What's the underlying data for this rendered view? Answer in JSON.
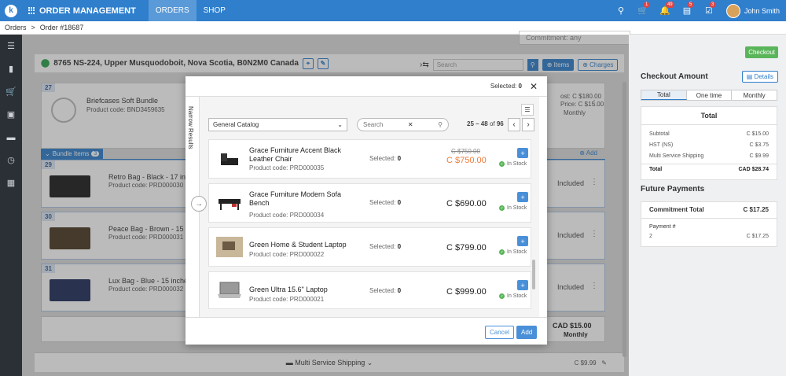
{
  "topbar": {
    "logo": "k",
    "app_title": "ORDER MANAGEMENT",
    "nav": [
      "ORDERS",
      "SHOP"
    ],
    "cart_badge": "1",
    "bell_badge": "49",
    "clip_badge": "5",
    "check_badge": "3",
    "user": "John Smith"
  },
  "breadcrumb": {
    "root": "Orders",
    "sep": ">",
    "current": "Order #18687"
  },
  "order": {
    "commitment": "Commitment: any",
    "address": "8765 NS-224, Upper Musquodoboit, Nova Scotia, B0N2M0 Canada",
    "search_placeholder": "Search",
    "items_btn": "Items",
    "charges_btn": "Charges",
    "bundle": {
      "num": "27",
      "name": "Briefcases Soft Bundle",
      "code": "Product code: BND3459635",
      "cost": "ost: C $180.00",
      "price": "Price: C $15.00",
      "period": "Monthly"
    },
    "bundle_label": "Bundle Items",
    "bundle_count": "3",
    "add_link": "Add",
    "items": [
      {
        "num": "29",
        "name": "Retro Bag - Black - 17 inches",
        "code": "Product code: PRD000030",
        "status": "Included"
      },
      {
        "num": "30",
        "name": "Peace Bag - Brown - 15 inches",
        "code": "Product code: PRD000031",
        "status": "Included"
      },
      {
        "num": "31",
        "name": "Lux Bag - Blue - 15 inches",
        "code": "Product code: PRD000032",
        "status": "Included"
      }
    ],
    "total": "CAD $15.00",
    "total_period": "Monthly",
    "shipping": "Multi Service Shipping",
    "shipping_price": "C $9.99"
  },
  "checkout": {
    "button": "Checkout",
    "title": "Checkout Amount",
    "details": "Details",
    "tabs": [
      "Total",
      "One time",
      "Monthly"
    ],
    "box_title": "Total",
    "rows": [
      {
        "label": "Subtotal",
        "value": "C $15.00"
      },
      {
        "label": "HST (NS)",
        "value": "C $3.75"
      },
      {
        "label": "Multi Service Shipping",
        "value": "C $9.99"
      }
    ],
    "total_label": "Total",
    "total_value": "CAD $28.74"
  },
  "future": {
    "title": "Future Payments",
    "commit_label": "Commitment Total",
    "commit_value": "C $17.25",
    "payment_label": "Payment #",
    "payment_num": "2",
    "payment_value": "C $17.25"
  },
  "modal": {
    "selected_label": "Selected:",
    "selected_count": "0",
    "narrow": "Narrow Results",
    "catalog": "General Catalog",
    "search_placeholder": "Search",
    "range": "25 – 48",
    "of": "of",
    "total": "96",
    "cancel": "Cancel",
    "add": "Add",
    "products": [
      {
        "name": "Grace Furniture Accent Black Leather Chair",
        "code": "Product code:  PRD000035",
        "selected": "0",
        "old_price": "C $750.00",
        "price": "C $750.00",
        "stock": "In Stock"
      },
      {
        "name": "Grace Furniture Modern Sofa Bench",
        "code": "Product code:  PRD000034",
        "selected": "0",
        "price": "C $690.00",
        "stock": "In Stock"
      },
      {
        "name": "Green Home & Student Laptop",
        "code": "Product code:  PRD000022",
        "selected": "0",
        "price": "C $799.00",
        "stock": "In Stock"
      },
      {
        "name": "Green Ultra 15.6\" Laptop",
        "code": "Product code:  PRD000021",
        "selected": "0",
        "price": "C $999.00",
        "stock": "In Stock"
      }
    ]
  }
}
